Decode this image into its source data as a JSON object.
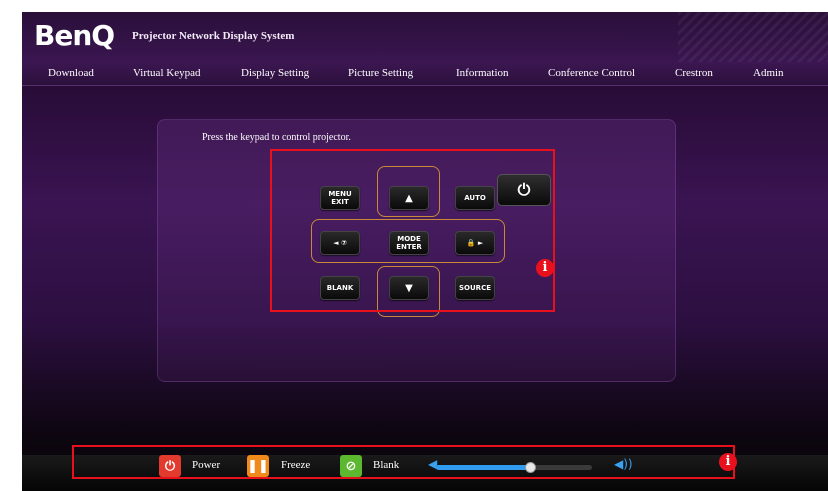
{
  "header": {
    "logo": "BenQ",
    "system_title": "Projector Network Display System"
  },
  "nav": {
    "items": [
      "Download",
      "Virtual Keypad",
      "Display Setting",
      "Picture Setting",
      "Information",
      "Conference Control",
      "Crestron",
      "Admin"
    ]
  },
  "keypad": {
    "instruction": "Press the keypad to control projector.",
    "menu_exit": [
      "MENU",
      "EXIT"
    ],
    "up": "▲",
    "auto": "AUTO",
    "left": "◄ ⑦",
    "mode_enter": [
      "MODE",
      "ENTER"
    ],
    "right": "🔒 ►",
    "blank": "BLANK",
    "down": "▼",
    "source": "SOURCE",
    "power": "⏻",
    "info_icon": "i"
  },
  "bottom_bar": {
    "power_label": "Power",
    "freeze_label": "Freeze",
    "blank_label": "Blank",
    "power_icon": "power-icon",
    "freeze_icon": "pause-icon",
    "blank_icon": "no-image-icon",
    "volume_level": 0.6,
    "info_icon": "i"
  },
  "colors": {
    "highlight": "#e8101c",
    "keypad_outline": "#c8893a",
    "power_icon_bg": "#e23b2e",
    "freeze_icon_bg": "#f08a1c",
    "blank_icon_bg": "#5cb82e",
    "volume_accent": "#2f9cf0"
  }
}
